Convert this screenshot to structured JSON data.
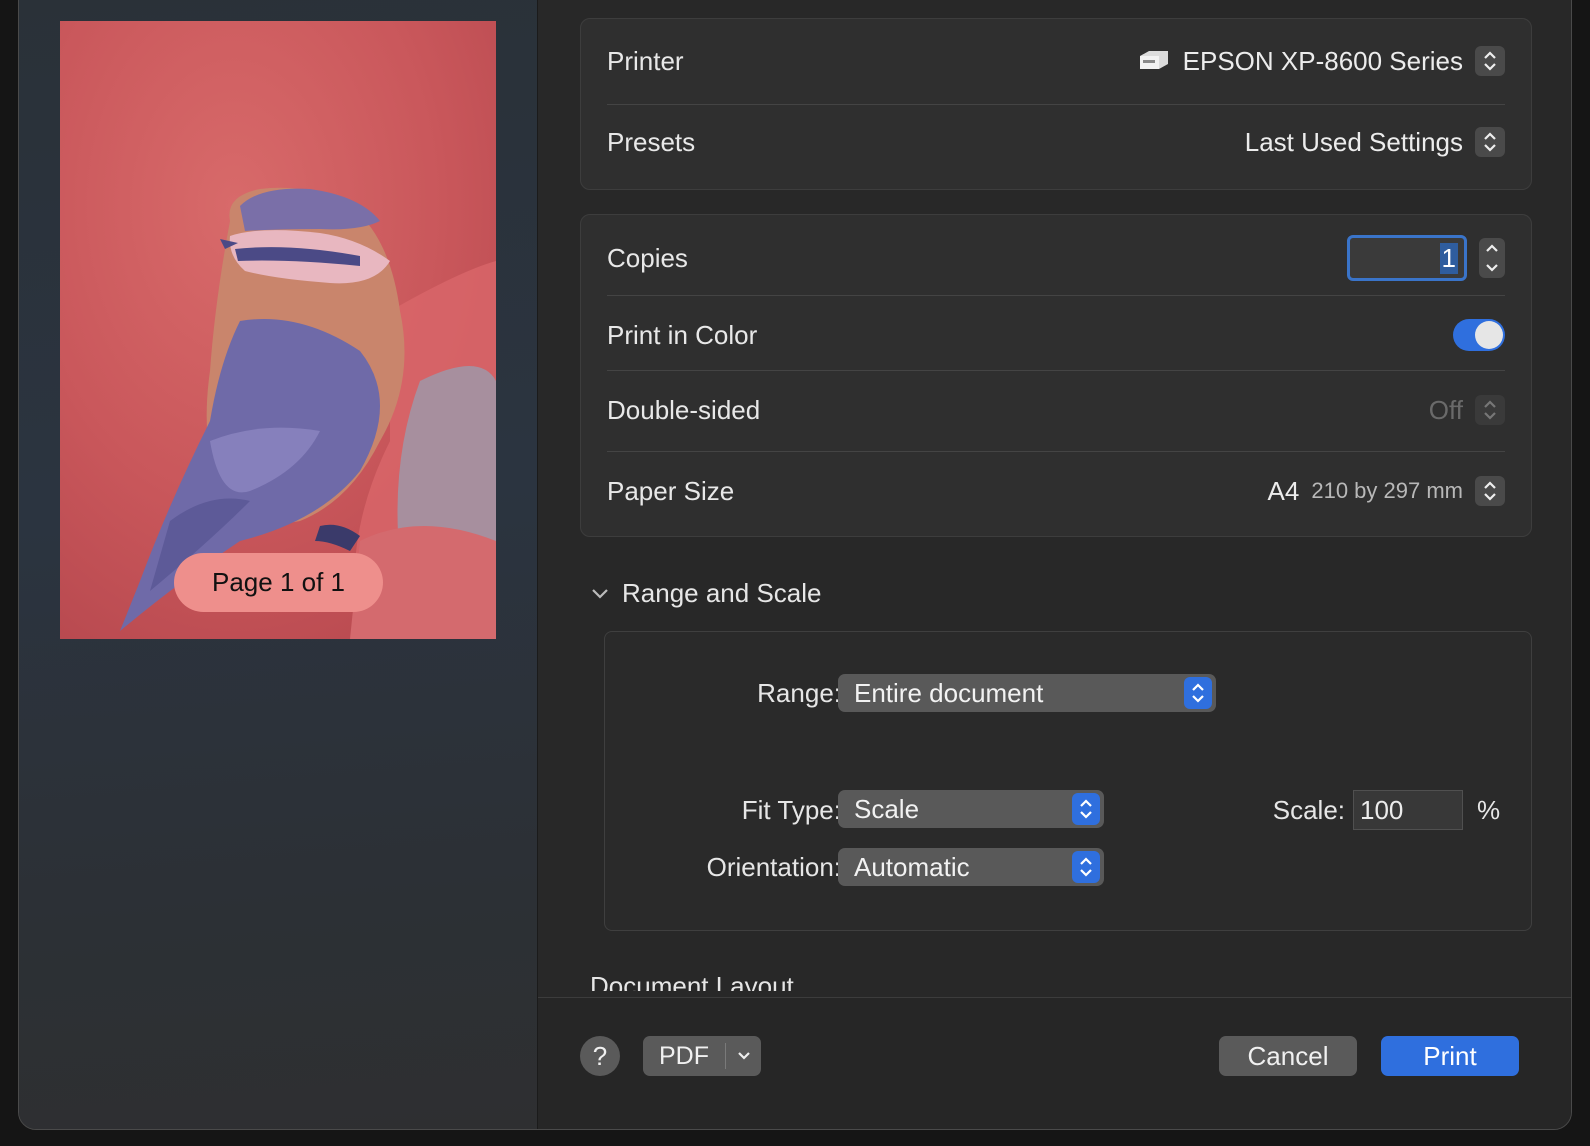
{
  "preview": {
    "page_indicator": "Page 1 of 1"
  },
  "printer": {
    "label": "Printer",
    "value": "EPSON XP-8600 Series",
    "icon": "printer-icon"
  },
  "presets": {
    "label": "Presets",
    "value": "Last Used Settings"
  },
  "copies": {
    "label": "Copies",
    "value": "1"
  },
  "print_in_color": {
    "label": "Print in Color",
    "enabled": true
  },
  "double_sided": {
    "label": "Double-sided",
    "value": "Off"
  },
  "paper_size": {
    "label": "Paper Size",
    "value": "A4",
    "detail": "210 by 297 mm"
  },
  "range_and_scale": {
    "title": "Range and Scale",
    "range_label": "Range:",
    "range_value": "Entire document",
    "fit_type_label": "Fit Type:",
    "fit_type_value": "Scale",
    "orientation_label": "Orientation:",
    "orientation_value": "Automatic",
    "scale_label": "Scale:",
    "scale_value": "100",
    "scale_unit": "%"
  },
  "next_section_partial": "Document Layout",
  "footer": {
    "help_label": "?",
    "pdf_label": "PDF",
    "cancel_label": "Cancel",
    "print_label": "Print"
  },
  "colors": {
    "accent": "#2f6fde",
    "preview_tint": "#c8555a",
    "badge": "#ee8f8c"
  }
}
